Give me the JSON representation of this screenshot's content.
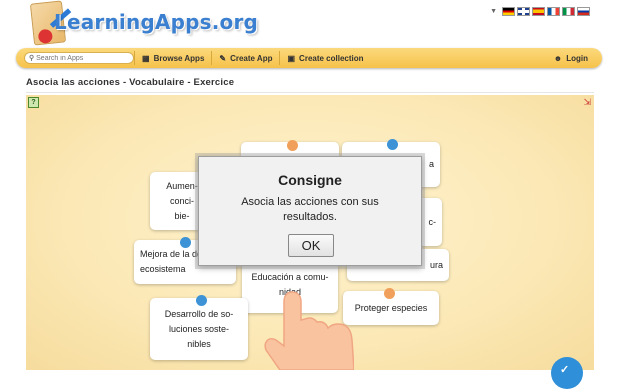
{
  "header": {
    "logo_text": "LearningApps.org",
    "flags": [
      {
        "name": "de-flag",
        "colors": [
          "#000000",
          "#dd0000",
          "#ffce00"
        ]
      },
      {
        "name": "uk-flag",
        "colors": [
          "#1f3f8f",
          "#c8102e",
          "#ffffff"
        ]
      },
      {
        "name": "es-flag",
        "colors": [
          "#c60b1e",
          "#ffc400",
          "#c60b1e"
        ]
      },
      {
        "name": "fr-flag",
        "colors": [
          "#0055a4",
          "#ffffff",
          "#ef4135"
        ]
      },
      {
        "name": "it-flag",
        "colors": [
          "#009246",
          "#ffffff",
          "#ce2b37"
        ]
      },
      {
        "name": "ru-flag",
        "colors": [
          "#ffffff",
          "#0039a6",
          "#d52b1e"
        ]
      }
    ]
  },
  "nav": {
    "search_placeholder": "Search in Apps",
    "browse_label": "Browse Apps",
    "create_app_label": "Create App",
    "create_collection_label": "Create collection",
    "login_label": "Login"
  },
  "page": {
    "title": "Asocia las acciones - Vocabulaire - Exercice"
  },
  "cards": [
    {
      "text": "Aumen- conci- bie-",
      "dot": "none"
    },
    {
      "text": "Mejora de la del ecosistema",
      "dot": "blue"
    },
    {
      "text": "Desarrollo de so- luciones soste- nibles",
      "dot": "blue"
    },
    {
      "text": "Educación a comu- nidad",
      "dot": "none"
    },
    {
      "text": "",
      "dot": "orange"
    },
    {
      "text": "a",
      "dot": "blue"
    },
    {
      "text": "c-",
      "dot": "none"
    },
    {
      "text": "ura",
      "dot": "none"
    },
    {
      "text": "Proteger especies",
      "dot": "orange"
    }
  ],
  "dialog": {
    "title": "Consigne",
    "message": "Asocia las acciones con sus resultados.",
    "ok_label": "OK"
  },
  "colors": {
    "accent_blue": "#3d93d6",
    "accent_orange": "#f0a05a",
    "nav_yellow": "#f6c24a"
  }
}
